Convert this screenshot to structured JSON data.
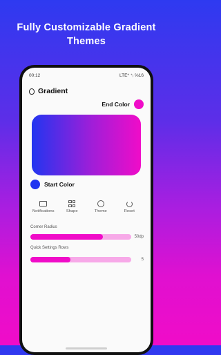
{
  "headline": {
    "line1": "Fully Customizable Gradient",
    "line2": "Themes"
  },
  "status": {
    "time": "00:12",
    "right": "LTE* ⁺ᵢ ℅16"
  },
  "app": {
    "title": "Gradient"
  },
  "colors": {
    "end": "#f00cc8",
    "start": "#1f34f0",
    "preview_from": "#2235f0",
    "preview_to": "#f00cc8"
  },
  "end_color": {
    "label": "End Color"
  },
  "start_color": {
    "label": "Start Color"
  },
  "actions": [
    {
      "label": "Notifications",
      "icon": "chat-bubble-icon"
    },
    {
      "label": "Shape",
      "icon": "grid-icon"
    },
    {
      "label": "Theme",
      "icon": "palette-icon"
    },
    {
      "label": "Reset",
      "icon": "reset-icon"
    }
  ],
  "corner_radius": {
    "label": "Corner Radius",
    "value": "50dp",
    "fraction": 0.72
  },
  "quick_settings_rows": {
    "label": "Quick Settings Rows",
    "value": "5",
    "fraction": 0.4
  }
}
